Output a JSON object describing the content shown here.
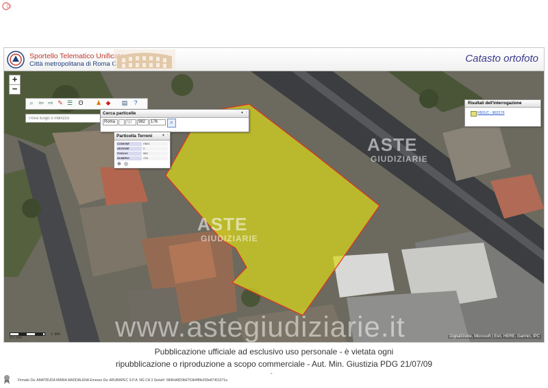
{
  "header": {
    "line1": "Sportello Telematico Unificato",
    "line2": "Città metropolitana di Roma Capitale",
    "title": "Catasto ortofoto"
  },
  "map_controls": {
    "zoom_in": "+",
    "zoom_out": "−",
    "search_placeholder": "Trova luogo o indirizzo",
    "toolbar_icons": [
      "zoom-icon",
      "back-icon",
      "forward-icon",
      "pencil-icon",
      "legend-icon",
      "binoculars-icon",
      "person-icon",
      "layers-icon",
      "print-icon",
      "help-icon"
    ]
  },
  "cerca_particelle": {
    "title": "Cerca particelle",
    "comune": "Roma",
    "sezione_placeholder": "-",
    "foglio_placeholder": "fgz",
    "foglio": "982",
    "particella": "176",
    "search_icon": "magnifier-icon"
  },
  "particella_terreni": {
    "title": "Particella Terreni",
    "rows": [
      {
        "key": "COMUNE",
        "value": "H501"
      },
      {
        "key": "SEZIONE",
        "value": "C"
      },
      {
        "key": "FOGLIO",
        "value": "982"
      },
      {
        "key": "NUMERO",
        "value": "176"
      }
    ]
  },
  "results": {
    "title": "Risultati dell'interrogazione",
    "item": "H501/C - 982/176"
  },
  "scale_bar": {
    "label": "0   5   10m",
    "ratio": "1: 984"
  },
  "attribution": "DigitalGlobe, Microsoft | Esri, HERE, Garmin, IPC",
  "watermarks": {
    "aste": "ASTE",
    "giudiziarie": "GIUDIZIARIE",
    "url": "www.astegiudiziarie.it"
  },
  "caption": {
    "line1": "Pubblicazione ufficiale ad esclusivo uso personale - è vietata ogni",
    "line2": "ripubblicazione o riproduzione a scopo commerciale - Aut. Min. Giustizia PDG 21/07/09",
    "dash": "-"
  },
  "footer": {
    "signature": "Firmato Da: AMATRUDA MARIA MADDALENA Emesso Da: ARUBAPEC S.P.A. NG CA 3 Serial#: 6846d4829b6753b4f8fe209e87451071a"
  },
  "colors": {
    "parcel_fill": "#d8d81a",
    "parcel_stroke": "#e03020",
    "title_blue": "#3a3a8c"
  }
}
